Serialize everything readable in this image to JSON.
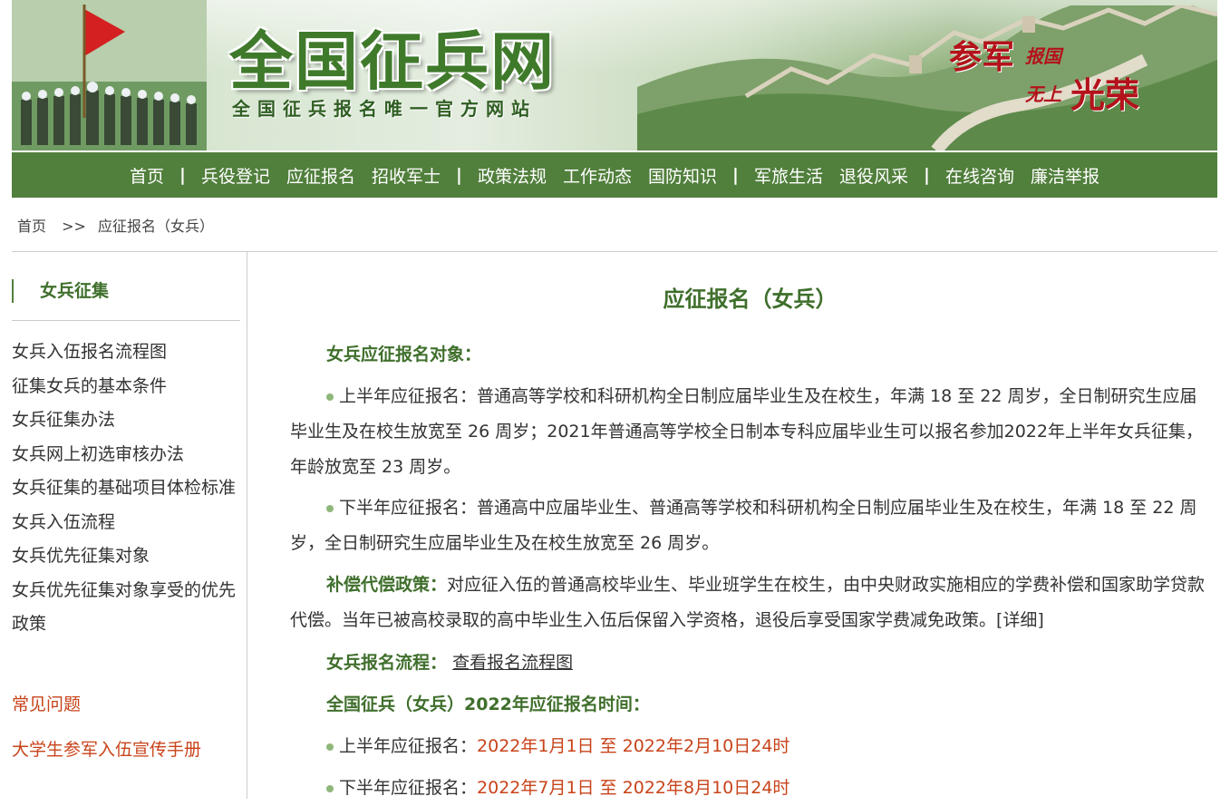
{
  "banner": {
    "title": "全国征兵网",
    "subtitle": "全国征兵报名唯一官方网站",
    "slogan": {
      "a": "参军",
      "b": "报国",
      "c": "无上",
      "d": "光荣"
    }
  },
  "nav": {
    "items": [
      "首页",
      "兵役登记",
      "应征报名",
      "招收军士",
      "政策法规",
      "工作动态",
      "国防知识",
      "军旅生活",
      "退役风采",
      "在线咨询",
      "廉洁举报"
    ],
    "separator": "|"
  },
  "breadcrumb": {
    "home": "首页",
    "sep": ">>",
    "current": "应征报名（女兵）"
  },
  "sidebar": {
    "title": "女兵征集",
    "items": [
      "女兵入伍报名流程图",
      "征集女兵的基本条件",
      "女兵征集办法",
      "女兵网上初选审核办法",
      "女兵征集的基础项目体检标准",
      "女兵入伍流程",
      "女兵优先征集对象",
      "女兵优先征集对象享受的优先政策"
    ],
    "faq": "常见问题",
    "manual": "大学生参军入伍宣传手册"
  },
  "main": {
    "title": "应征报名（女兵）",
    "target_heading": "女兵应征报名对象：",
    "first_half": "上半年应征报名：普通高等学校和科研机构全日制应届毕业生及在校生，年满 18 至 22 周岁，全日制研究生应届毕业生及在校生放宽至 26 周岁；2021年普通高等学校全日制本专科应届毕业生可以报名参加2022年上半年女兵征集，年龄放宽至 23 周岁。",
    "second_half": "下半年应征报名：普通高中应届毕业生、普通高等学校和科研机构全日制应届毕业生及在校生，年满 18 至 22 周岁，全日制研究生应届毕业生及在校生放宽至 26 周岁。",
    "comp_heading": "补偿代偿政策：",
    "comp_text": "对应征入伍的普通高校毕业生、毕业班学生在校生，由中央财政实施相应的学费补偿和国家助学贷款代偿。当年已被高校录取的高中毕业生入伍后保留入学资格，退役后享受国家学费减免政策。[详细]",
    "flow_heading": "女兵报名流程：",
    "flow_link": "查看报名流程图",
    "time_heading": "全国征兵（女兵）2022年应征报名时间：",
    "time_first_label": "上半年应征报名：",
    "time_first_value": "2022年1月1日 至 2022年2月10日24时",
    "time_second_label": "下半年应征报名：",
    "time_second_value": "2022年7月1日 至 2022年8月10日24时"
  },
  "colors": {
    "green": "#517f3c",
    "title_green": "#3f6f2c",
    "red": "#c8431a"
  }
}
